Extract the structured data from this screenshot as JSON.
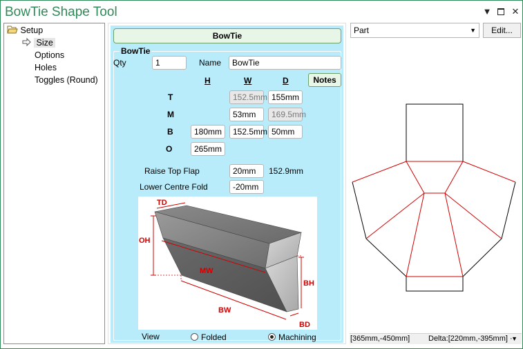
{
  "window": {
    "title": "BowTie Shape Tool"
  },
  "tree": {
    "items": [
      {
        "label": "Setup"
      },
      {
        "label": "Size"
      },
      {
        "label": "Options"
      },
      {
        "label": "Holes"
      },
      {
        "label": "Toggles (Round)"
      }
    ]
  },
  "panel": {
    "header": "BowTie",
    "group_label": "BowTie",
    "qty_label": "Qty",
    "qty_value": "1",
    "name_label": "Name",
    "name_value": "BowTie",
    "col_h": "H",
    "col_w": "W",
    "col_d": "D",
    "notes_label": "Notes",
    "rows": {
      "t": {
        "label": "T",
        "w": "152.5mm",
        "d": "155mm"
      },
      "m": {
        "label": "M",
        "w": "53mm",
        "d": "169.5mm"
      },
      "b": {
        "label": "B",
        "h": "180mm",
        "w": "152.5mm",
        "d": "50mm"
      },
      "o": {
        "label": "O",
        "h": "265mm"
      }
    },
    "raise_top_flap_label": "Raise Top Flap",
    "raise_top_flap_value": "20mm",
    "raise_top_flap_result": "152.9mm",
    "lower_centre_fold_label": "Lower Centre Fold",
    "lower_centre_fold_value": "-20mm",
    "diagram_labels": {
      "td": "TD",
      "oh": "OH",
      "mw": "MW",
      "bw": "BW",
      "bh": "BH",
      "bd": "BD"
    },
    "view_label": "View",
    "view_options": [
      "Folded",
      "Machining"
    ],
    "view_selected": "Machining"
  },
  "right": {
    "select_value": "Part",
    "edit_label": "Edit...",
    "status_left": "[365mm,-450mm]",
    "status_right": "Delta:[220mm,-395mm] ·"
  },
  "colors": {
    "accent": "#2e8b57",
    "panel_bg": "#b9ecfa",
    "cut_line": "#d00000"
  }
}
